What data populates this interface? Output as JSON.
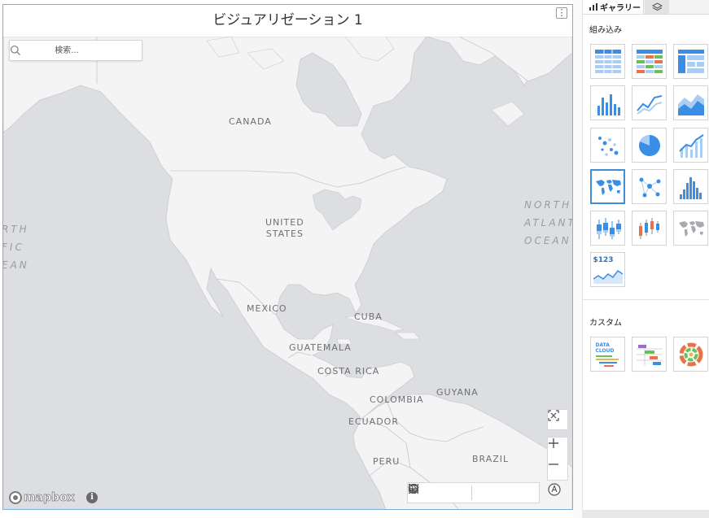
{
  "visualization": {
    "title": "ビジュアリゼーション 1",
    "menu_glyph": "⋮",
    "search": {
      "placeholder": "検索..."
    },
    "map": {
      "labels": {
        "canada": "CANADA",
        "united_states": "UNITED\nSTATES",
        "mexico": "MEXICO",
        "cuba": "CUBA",
        "guatemala": "GUATEMALA",
        "costa_rica": "COSTA RICA",
        "colombia": "COLOMBIA",
        "guyana": "GUYANA",
        "ecuador": "ECUADOR",
        "peru": "PERU",
        "brazil": "BRAZIL",
        "north_atlantic_ocean": "NORTH\nATLANTIC\nOCEAN",
        "north_pacific_ocean": "RTH\nFIC\nEAN"
      },
      "attribution": {
        "logo_text": "mapbox",
        "info_glyph": "i"
      },
      "colors": {
        "land": "#f4f4f5",
        "water": "#dcdee1",
        "border": "#c4c6c9",
        "accent": "#3f8fd6"
      }
    },
    "controls": {
      "fit_bounds_icon": "fit-bounds-icon",
      "zoom_in_icon": "plus-icon",
      "zoom_out_icon": "minus-icon",
      "compass_icon": "compass-icon",
      "tools": [
        "rectangle-select-icon",
        "lasso-select-icon",
        "circle-select-icon",
        "layers-icon",
        "globe-icon",
        "legend-list-icon"
      ]
    }
  },
  "gallery": {
    "tabs": [
      {
        "label": "ギャラリー",
        "icon": "bar-chart-icon",
        "active": true
      },
      {
        "label": "",
        "icon": "layers-icon",
        "active": false
      }
    ],
    "builtin_label": "組み込み",
    "custom_label": "カスタム",
    "builtin_tiles": [
      "table",
      "colored-table",
      "pivot-table",
      "bar-chart",
      "line-chart",
      "area-chart",
      "scatter-chart",
      "pie-chart",
      "combo-chart",
      "map-chart",
      "network-chart",
      "histogram-chart",
      "boxplot-chart",
      "candlestick-chart",
      "heat-map",
      "kpi-chart"
    ],
    "selected_tile": "map-chart",
    "kpi_tile_text": "$123",
    "custom_tiles": [
      "data-cloud",
      "gantt-chart",
      "sunburst-chart"
    ],
    "data_cloud_text": "DATA\nCLOUD"
  }
}
